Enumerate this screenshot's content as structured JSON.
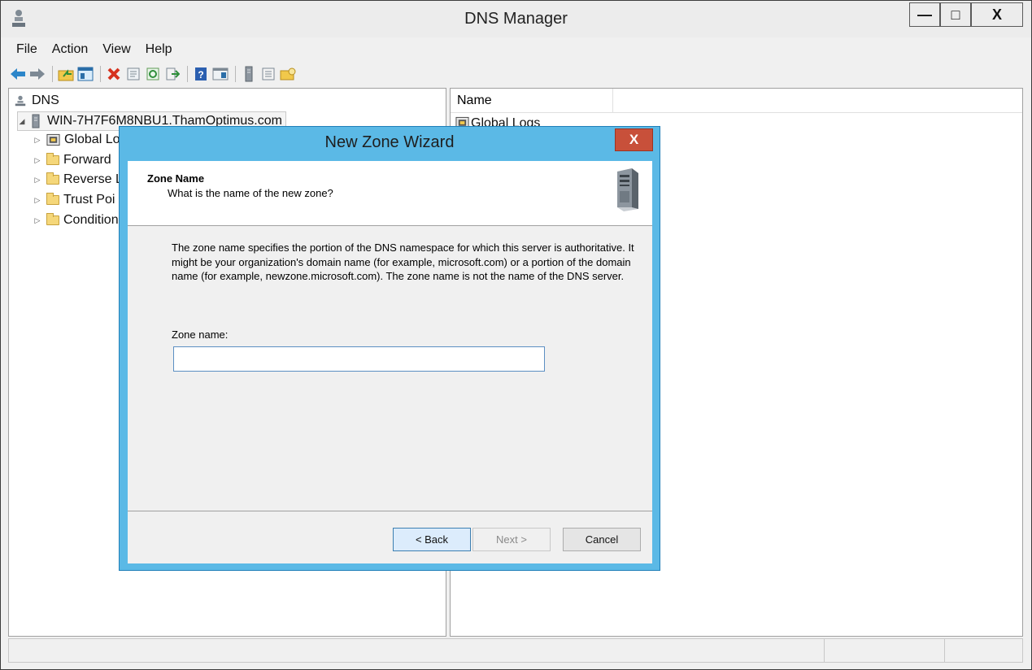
{
  "window": {
    "title": "DNS Manager",
    "min_glyph": "—",
    "max_glyph": "□",
    "close_glyph": "X"
  },
  "menu": [
    "File",
    "Action",
    "View",
    "Help"
  ],
  "tree": {
    "root": "DNS",
    "server": "WIN-7H7F6M8NBU1.ThamOptimus.com",
    "children": [
      "Global Lo",
      "Forward",
      "Reverse L",
      "Trust Poi",
      "Condition"
    ]
  },
  "list": {
    "column_name": "Name",
    "first_item": "Global Logs"
  },
  "dialog": {
    "title": "New Zone Wizard",
    "close_glyph": "X",
    "header_title": "Zone Name",
    "header_subtitle": "What is the name of the new zone?",
    "description": "The zone name specifies the portion of the DNS namespace for which this server is authoritative. It might be your organization's domain name (for example, microsoft.com) or a portion of the domain name (for example, newzone.microsoft.com). The zone name is not the name of the DNS server.",
    "zone_label": "Zone name:",
    "zone_value": "",
    "back_label": "< Back",
    "next_label": "Next >",
    "cancel_label": "Cancel"
  },
  "colors": {
    "dialog_frame": "#5bb9e6",
    "close_button": "#c8503a"
  }
}
